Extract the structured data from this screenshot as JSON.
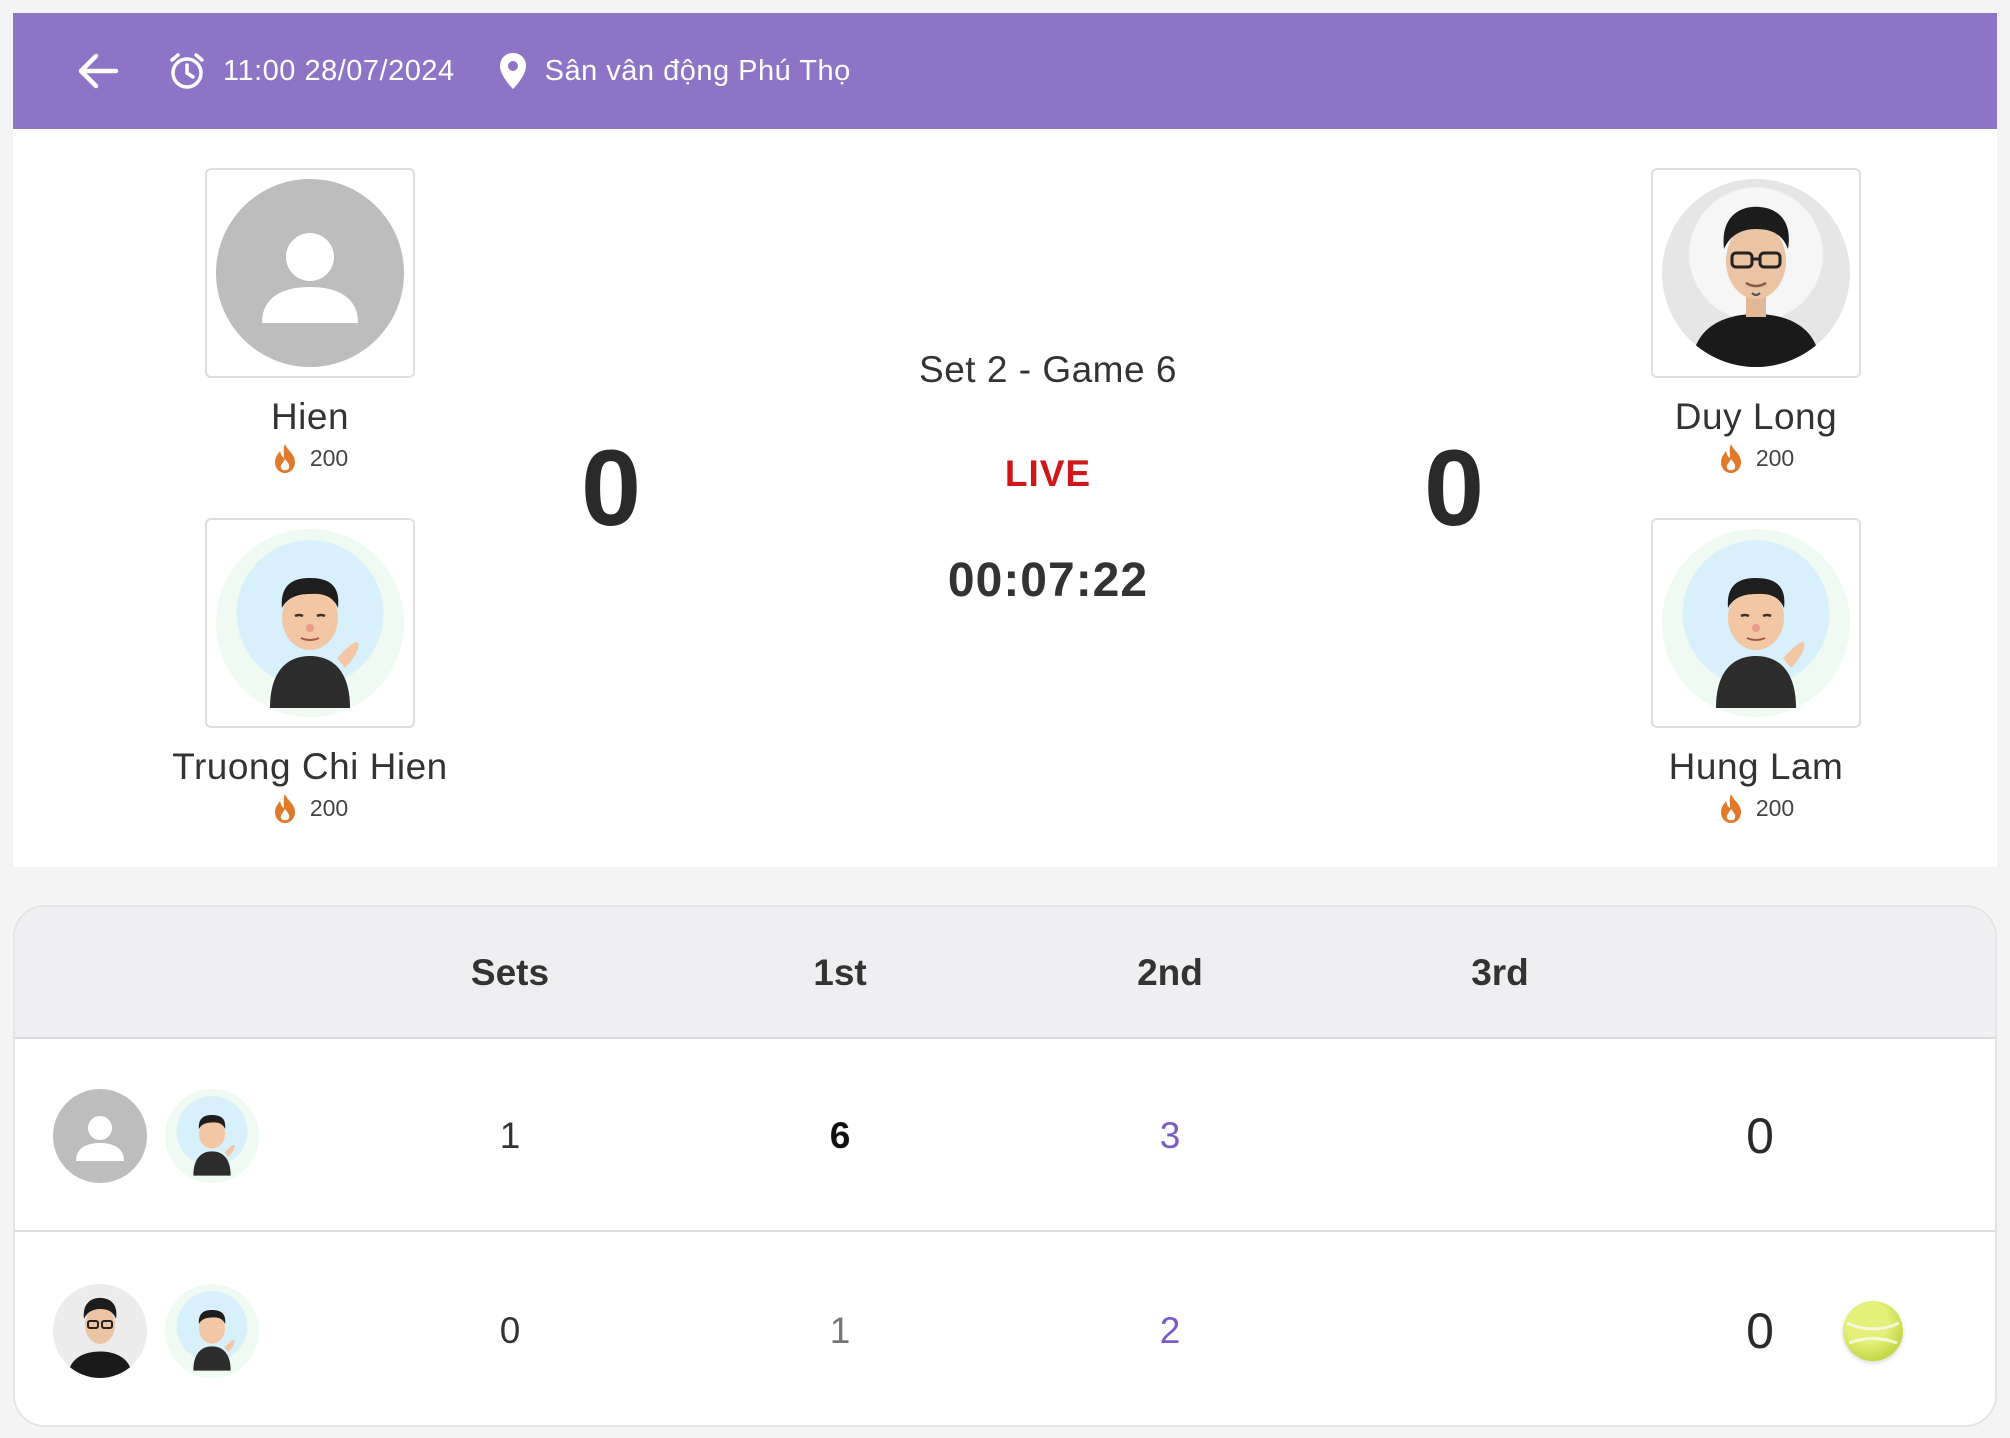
{
  "header": {
    "time": "11:00 28/07/2024",
    "location": "Sân vân động Phú Thọ",
    "back_icon": "arrow-left-icon",
    "time_icon": "alarm-clock-icon",
    "location_icon": "map-pin-icon",
    "bg_color": "#8e74c6"
  },
  "match": {
    "set_label": "Set 2 - Game 6",
    "status": "LIVE",
    "timer": "00:07:22",
    "score_left": "0",
    "score_right": "0",
    "players": [
      {
        "name": "Hien",
        "points": "200",
        "avatar": "default-user-icon"
      },
      {
        "name": "Truong Chi Hien",
        "points": "200",
        "avatar": "cartoon-avatar"
      },
      {
        "name": "Duy Long",
        "points": "200",
        "avatar": "photo-avatar"
      },
      {
        "name": "Hung Lam",
        "points": "200",
        "avatar": "cartoon-avatar"
      }
    ]
  },
  "scoreboard": {
    "headers": [
      "Sets",
      "1st",
      "2nd",
      "3rd"
    ],
    "rows": [
      {
        "sets": "1",
        "first": "6",
        "second": "3",
        "third": "",
        "game": "0",
        "serving": false
      },
      {
        "sets": "0",
        "first": "1",
        "second": "2",
        "third": "",
        "game": "0",
        "serving": true
      }
    ],
    "accent_color": "#7a5cc7",
    "live_color": "#d0161b",
    "serve_icon": "tennis-ball-icon"
  }
}
